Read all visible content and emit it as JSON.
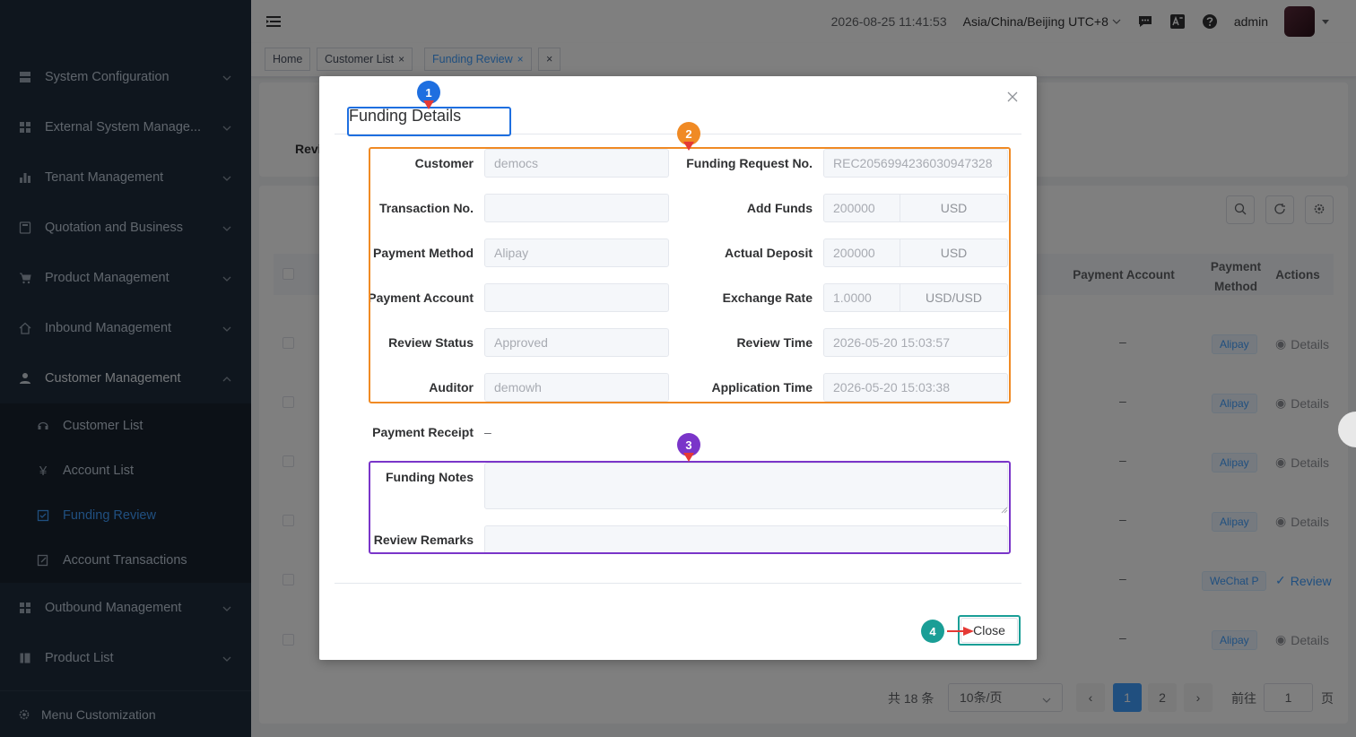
{
  "sidebar": {
    "menu": [
      {
        "label": "System Configuration",
        "icon": "server-icon"
      },
      {
        "label": "External System Manage...",
        "icon": "grid-icon"
      },
      {
        "label": "Tenant Management",
        "icon": "bar-chart-icon"
      },
      {
        "label": "Quotation and Business",
        "icon": "calculator-icon"
      },
      {
        "label": "Product Management",
        "icon": "cart-icon"
      },
      {
        "label": "Inbound Management",
        "icon": "home-icon"
      },
      {
        "label": "Customer Management",
        "icon": "user-icon"
      }
    ],
    "submenu": [
      {
        "label": "Customer List",
        "icon": "support-icon"
      },
      {
        "label": "Account List",
        "icon": "yen-icon"
      },
      {
        "label": "Funding Review",
        "icon": "checkbox-icon"
      },
      {
        "label": "Account Transactions",
        "icon": "edit-doc-icon"
      }
    ],
    "menu_after": [
      {
        "label": "Outbound Management",
        "icon": "grid-icon"
      },
      {
        "label": "Product List",
        "icon": "book-icon"
      }
    ],
    "footer": "Menu Customization"
  },
  "header": {
    "datetime": "2026-08-25 11:41:53",
    "timezone": "Asia/China/Beijing UTC+8",
    "user": "admin"
  },
  "tags": [
    {
      "label": "Home"
    },
    {
      "label": "Customer List"
    },
    {
      "label": "Funding Review"
    }
  ],
  "behind": {
    "filter_label_partial": "Revi",
    "columns": {
      "payment_account": "Payment Account",
      "payment_method": "Payment Method",
      "actions": "Actions"
    },
    "rows": [
      {
        "account": "–",
        "method": "Alipay",
        "action": "Details"
      },
      {
        "account": "–",
        "method": "Alipay",
        "action": "Details"
      },
      {
        "account": "–",
        "method": "Alipay",
        "action": "Details"
      },
      {
        "account": "–",
        "method": "Alipay",
        "action": "Details"
      },
      {
        "account": "–",
        "method": "WeChat P",
        "action": "Review"
      },
      {
        "account": "–",
        "method": "Alipay",
        "action": "Details"
      }
    ],
    "pagination": {
      "total": "共 18 条",
      "page_size": "10条/页",
      "pages": [
        "1",
        "2"
      ],
      "goto_label": "前往",
      "goto_value": "1",
      "page_suffix": "页"
    }
  },
  "modal": {
    "title": "Funding Details",
    "fields": {
      "customer": {
        "label": "Customer",
        "value": "democs"
      },
      "request_no": {
        "label": "Funding Request No.",
        "value": "REC2056994236030947328"
      },
      "transaction_no": {
        "label": "Transaction No.",
        "value": ""
      },
      "add_funds": {
        "label": "Add Funds",
        "value": "200000",
        "unit": "USD"
      },
      "payment_method": {
        "label": "Payment Method",
        "value": "Alipay"
      },
      "actual_deposit": {
        "label": "Actual Deposit",
        "value": "200000",
        "unit": "USD"
      },
      "payment_account": {
        "label": "Payment Account",
        "value": ""
      },
      "exchange_rate": {
        "label": "Exchange Rate",
        "value": "1.0000",
        "unit": "USD/USD"
      },
      "review_status": {
        "label": "Review Status",
        "value": "Approved"
      },
      "review_time": {
        "label": "Review Time",
        "value": "2026-05-20 15:03:57"
      },
      "auditor": {
        "label": "Auditor",
        "value": "demowh"
      },
      "application_time": {
        "label": "Application Time",
        "value": "2026-05-20 15:03:38"
      },
      "payment_receipt": {
        "label": "Payment Receipt",
        "value": "–"
      },
      "funding_notes": {
        "label": "Funding Notes",
        "value": ""
      },
      "review_remarks": {
        "label": "Review Remarks",
        "value": ""
      }
    },
    "close_label": "Close"
  },
  "annotations": [
    {
      "number": "1",
      "color": "#1e6fe0"
    },
    {
      "number": "2",
      "color": "#f08a24"
    },
    {
      "number": "3",
      "color": "#7a35c9"
    },
    {
      "number": "4",
      "color": "#1a9e96"
    }
  ]
}
